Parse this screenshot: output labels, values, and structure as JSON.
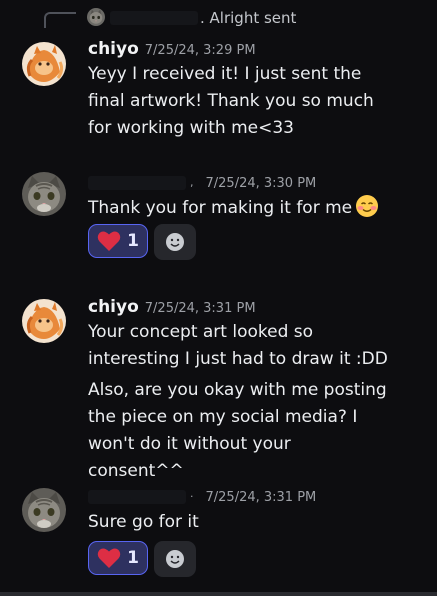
{
  "reply": {
    "text": ". Alright sent"
  },
  "messages": [
    {
      "author": "chiyo",
      "timestamp": "7/25/24, 3:29 PM",
      "lines": [
        "Yeyy I received it! I just sent the final artwork! Thank you so much for working with me<33"
      ]
    },
    {
      "author": "",
      "timestamp": "7/25/24, 3:30 PM",
      "lines": [
        "Thank you for making it for me"
      ],
      "reaction": {
        "emoji": "heart",
        "count": "1"
      }
    },
    {
      "author": "chiyo",
      "timestamp": "7/25/24, 3:31 PM",
      "lines": [
        "Your concept art looked so interesting I just had to draw it :DD",
        "Also, are you okay with me posting the piece on my social media? I won't do it without your consent^^"
      ]
    },
    {
      "author": "",
      "timestamp": "7/25/24, 3:31 PM",
      "lines": [
        "Sure go for it"
      ],
      "reaction": {
        "emoji": "heart",
        "count": "1"
      }
    }
  ],
  "colors": {
    "background": "#0d0d10",
    "reaction_border": "#5865f2",
    "reaction_bg": "#2e3160",
    "heart": "#dd2e44"
  }
}
